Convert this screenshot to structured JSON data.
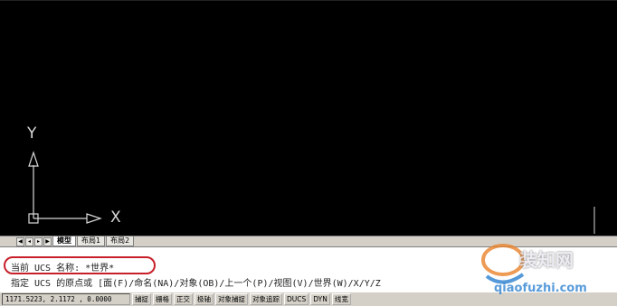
{
  "ucs_icon": {
    "y_label": "Y",
    "x_label": "X"
  },
  "tabs": [
    {
      "label": "模型",
      "active": true
    },
    {
      "label": "布局1",
      "active": false
    },
    {
      "label": "布局2",
      "active": false
    }
  ],
  "command": {
    "line1": "当前 UCS 名称: *世界*",
    "line2": "指定 UCS 的原点或 [面(F)/命名(NA)/对象(OB)/上一个(P)/视图(V)/世界(W)/X/Y/Z"
  },
  "status": {
    "coordinates": "1171.5223, 2.1172 , 0.0000",
    "buttons": [
      "捕捉",
      "栅格",
      "正交",
      "极轴",
      "对象捕捉",
      "对象追踪",
      "DUCS",
      "DYN",
      "线宽"
    ]
  },
  "watermark": {
    "line1": "装知网",
    "line2": "qiaofuzhi.com"
  },
  "colors": {
    "canvas": "#000000",
    "highlight": "#c8202a"
  }
}
